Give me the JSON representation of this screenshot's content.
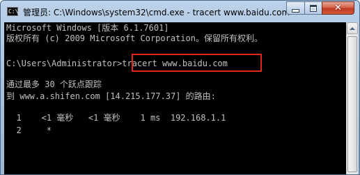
{
  "window": {
    "title": "管理员: C:\\Windows\\system32\\cmd.exe - tracert  www.baidu.com",
    "icon_name": "cmd-icon",
    "icon_glyph": "C:\\",
    "controls": {
      "minimize_icon": "minimize-icon",
      "maximize_icon": "maximize-icon",
      "close_icon": "close-icon",
      "close_glyph": "✕"
    }
  },
  "console": {
    "text_color": "#c0c0c0",
    "background": "#000000",
    "lines": [
      "Microsoft Windows [版本 6.1.7601]",
      "版权所有 (c) 2009 Microsoft Corporation。保留所有权利。",
      "",
      "C:\\Users\\Administrator>tracert www.baidu.com",
      "",
      "通过最多 30 个跃点跟踪",
      "到 www.a.shifen.com [14.215.177.37] 的路由:",
      "",
      "  1    <1 毫秒   <1 毫秒    1 ms  192.168.1.1",
      "  2     *"
    ]
  },
  "annotation": {
    "color": "#e0251c"
  }
}
